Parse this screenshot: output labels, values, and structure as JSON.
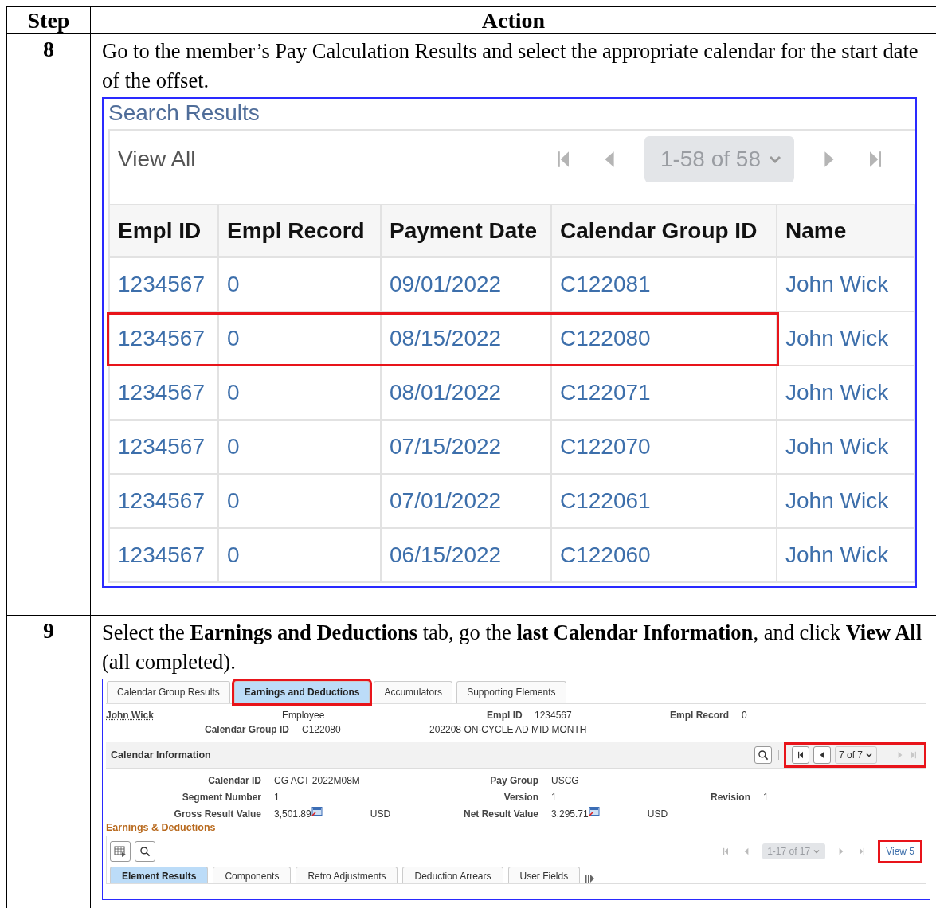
{
  "table": {
    "columns": [
      "Step",
      "Action"
    ],
    "rows": [
      {
        "step": "8",
        "instruction": "Go to the member’s Pay Calculation Results and select the appropriate calendar for the start date of the offset.",
        "screenshot": {
          "kind": "search_results",
          "title": "Search Results",
          "view_all": "View All",
          "pager": "1-58 of 58",
          "columns": [
            "Empl ID",
            "Empl Record",
            "Payment Date",
            "Calendar Group ID",
            "Name"
          ],
          "rows": [
            {
              "cells": [
                "1234567",
                "0",
                "09/01/2022",
                "C122081",
                "John Wick"
              ],
              "highlighted": false
            },
            {
              "cells": [
                "1234567",
                "0",
                "08/15/2022",
                "C122080",
                "John Wick"
              ],
              "highlighted": true
            },
            {
              "cells": [
                "1234567",
                "0",
                "08/01/2022",
                "C122071",
                "John Wick"
              ],
              "highlighted": false
            },
            {
              "cells": [
                "1234567",
                "0",
                "07/15/2022",
                "C122070",
                "John Wick"
              ],
              "highlighted": false
            },
            {
              "cells": [
                "1234567",
                "0",
                "07/01/2022",
                "C122061",
                "John Wick"
              ],
              "highlighted": false
            },
            {
              "cells": [
                "1234567",
                "0",
                "06/15/2022",
                "C122060",
                "John Wick"
              ],
              "highlighted": false
            }
          ]
        }
      },
      {
        "step": "9",
        "instruction": "Select the **Earnings and Deductions** tab, go the **last Calendar Information**, and click **View All** (all completed).",
        "screenshot": {
          "kind": "earnings",
          "tabs": [
            {
              "label": "Calendar Group Results",
              "selected": false,
              "highlighted": false
            },
            {
              "label": "Earnings and Deductions",
              "selected": true,
              "highlighted": true
            },
            {
              "label": "Accumulators",
              "selected": false,
              "highlighted": false
            },
            {
              "label": "Supporting Elements",
              "selected": false,
              "highlighted": false
            }
          ],
          "header": {
            "name": "John Wick",
            "role": "Employee",
            "empl_id_label": "Empl ID",
            "empl_id": "1234567",
            "empl_record_label": "Empl Record",
            "empl_record": "0",
            "calendar_group_label": "Calendar Group ID",
            "calendar_group": "C122080",
            "calendar_group_desc": "202208 ON-CYCLE AD MID MONTH"
          },
          "calendar": {
            "title": "Calendar Information",
            "pager": "7 of 7",
            "pager_highlighted": true,
            "lines": [
              [
                {
                  "label": "Calendar ID",
                  "value": "CG ACT 2022M08M"
                },
                {
                  "label": "Pay Group",
                  "value": "USCG"
                }
              ],
              [
                {
                  "label": "Segment Number",
                  "value": "1"
                },
                {
                  "label": "Version",
                  "value": "1"
                },
                {
                  "label": "Revision",
                  "value": "1"
                }
              ],
              [
                {
                  "label": "Gross Result Value",
                  "value": "3,501.89",
                  "unit": "USD"
                },
                {
                  "label": "Net Result Value",
                  "value": "3,295.71",
                  "unit": "USD"
                }
              ]
            ]
          },
          "earnings": {
            "title": "Earnings & Deductions",
            "pager": "1-17 of 17",
            "view_link": "View 5",
            "view_highlighted": true,
            "tabs": [
              {
                "label": "Element Results",
                "selected": true
              },
              {
                "label": "Components",
                "selected": false
              },
              {
                "label": "Retro Adjustments",
                "selected": false
              },
              {
                "label": "Deduction Arrears",
                "selected": false
              },
              {
                "label": "User Fields",
                "selected": false
              }
            ]
          }
        }
      }
    ]
  }
}
